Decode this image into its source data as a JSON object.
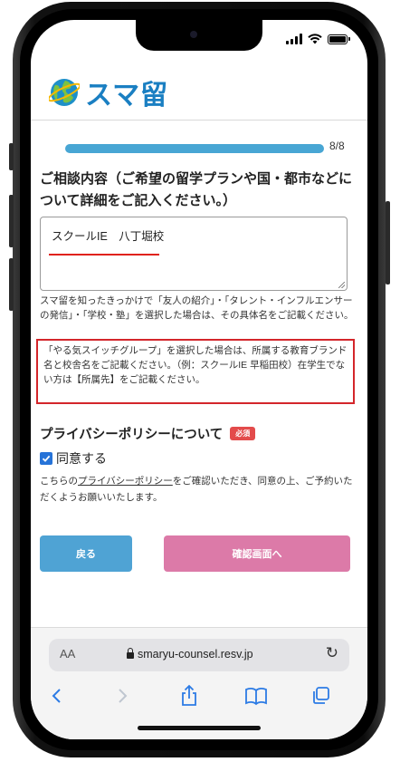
{
  "status_bar": {
    "icons": [
      "cellular-signal-icon",
      "wifi-icon",
      "battery-icon"
    ]
  },
  "header": {
    "logo_text": "スマ留",
    "logo_icon": "globe-icon"
  },
  "progress": {
    "fraction": 1.0,
    "text": "8/8",
    "color": "#48a6d4"
  },
  "question": {
    "label": "ご相談内容（ご希望の留学プランや国・都市などについて詳細をご記入ください。）"
  },
  "textarea": {
    "value": "スクールIE　八丁堀校"
  },
  "help_text_1": "スマ留を知ったきっかけで「友人の紹介」・「タレント・インフルエンサーの発信」・「学校・塾」を選択した場合は、その具体名をご記載ください。",
  "help_text_2": "「やる気スイッチグループ」を選択した場合は、所属する教育ブランド名と校舎名をご記載ください。（例：スクールIE 早稲田校）在学生でない方は【所属先】をご記載ください。",
  "privacy": {
    "title": "プライバシーポリシーについて",
    "required_badge": "必須",
    "agree_label": "同意する",
    "agree_checked": true,
    "text_before": "こちらの",
    "link_text": "プライバシーポリシー",
    "text_after": "をご確認いただき、同意の上、ご予約いただくようお願いいたします。"
  },
  "buttons": {
    "back": "戻る",
    "confirm": "確認画面へ"
  },
  "browser": {
    "aa_label": "AA",
    "url": "smaryu-counsel.resv.jp",
    "toolbar_icons": [
      "back-arrow-icon",
      "forward-arrow-icon",
      "share-icon",
      "bookmarks-icon",
      "tabs-icon"
    ]
  },
  "colors": {
    "brand_blue": "#1a7fc2",
    "progress": "#48a6d4",
    "back_button": "#4fa3d4",
    "confirm_button": "#dc7aa8",
    "highlight_red": "#d4262b",
    "required_badge": "#e34b4b"
  }
}
